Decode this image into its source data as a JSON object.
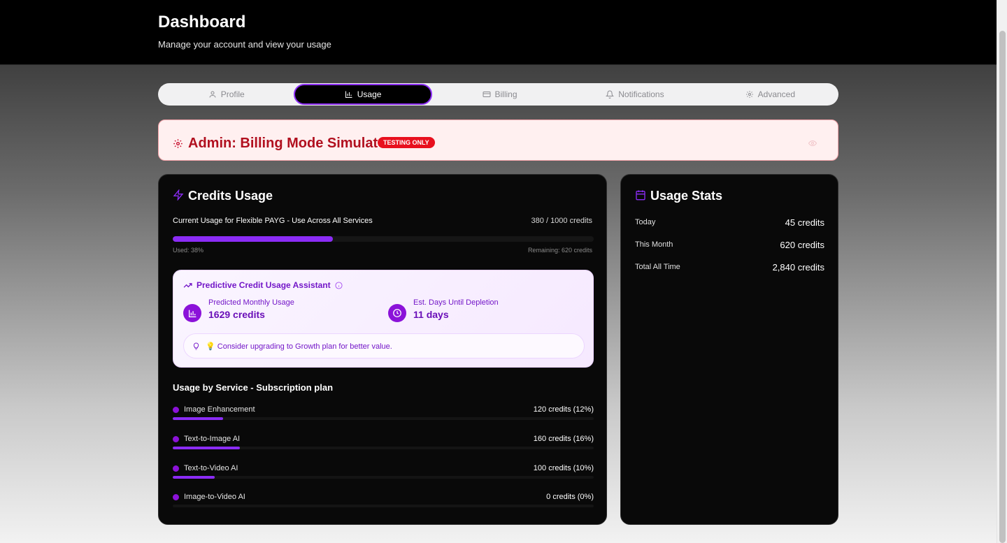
{
  "header": {
    "title": "Dashboard",
    "subtitle": "Manage your account and view your usage"
  },
  "tabs": [
    {
      "label": "Profile",
      "icon": "user-icon",
      "active": false
    },
    {
      "label": "Usage",
      "icon": "bar-chart-icon",
      "active": true
    },
    {
      "label": "Billing",
      "icon": "credit-card-icon",
      "active": false
    },
    {
      "label": "Notifications",
      "icon": "bell-icon",
      "active": false
    },
    {
      "label": "Advanced",
      "icon": "gear-icon",
      "active": false
    }
  ],
  "admin": {
    "title": "Admin: Billing Mode Simulator",
    "badge": "TESTING ONLY"
  },
  "credits": {
    "title": "Credits Usage",
    "usage_label": "Current Usage for Flexible PAYG - Use Across All Services",
    "usage_amount": "380 / 1000 credits",
    "used_text": "Used: 38%",
    "remaining_text": "Remaining: 620 credits",
    "used_fraction": 0.38
  },
  "predict": {
    "title": "Predictive Credit Usage Assistant",
    "monthly_label": "Predicted Monthly Usage",
    "monthly_value": "1629 credits",
    "depletion_label": "Est. Days Until Depletion",
    "depletion_value": "11 days",
    "tip": "💡 Consider upgrading to Growth plan for better value."
  },
  "services": {
    "title": "Usage by Service - Subscription plan",
    "items": [
      {
        "name": "Image Enhancement",
        "value": "120 credits (12%)",
        "fraction": 0.12
      },
      {
        "name": "Text-to-Image AI",
        "value": "160 credits (16%)",
        "fraction": 0.16
      },
      {
        "name": "Text-to-Video AI",
        "value": "100 credits (10%)",
        "fraction": 0.1
      },
      {
        "name": "Image-to-Video AI",
        "value": "0 credits (0%)",
        "fraction": 0.0
      }
    ]
  },
  "stats": {
    "title": "Usage Stats",
    "rows": [
      {
        "label": "Today",
        "value": "45 credits"
      },
      {
        "label": "This Month",
        "value": "620 credits"
      },
      {
        "label": "Total All Time",
        "value": "2,840 credits"
      }
    ]
  },
  "colors": {
    "accent": "#8b2cf5",
    "admin_red": "#b1101f",
    "predict_purple": "#7316c8"
  }
}
